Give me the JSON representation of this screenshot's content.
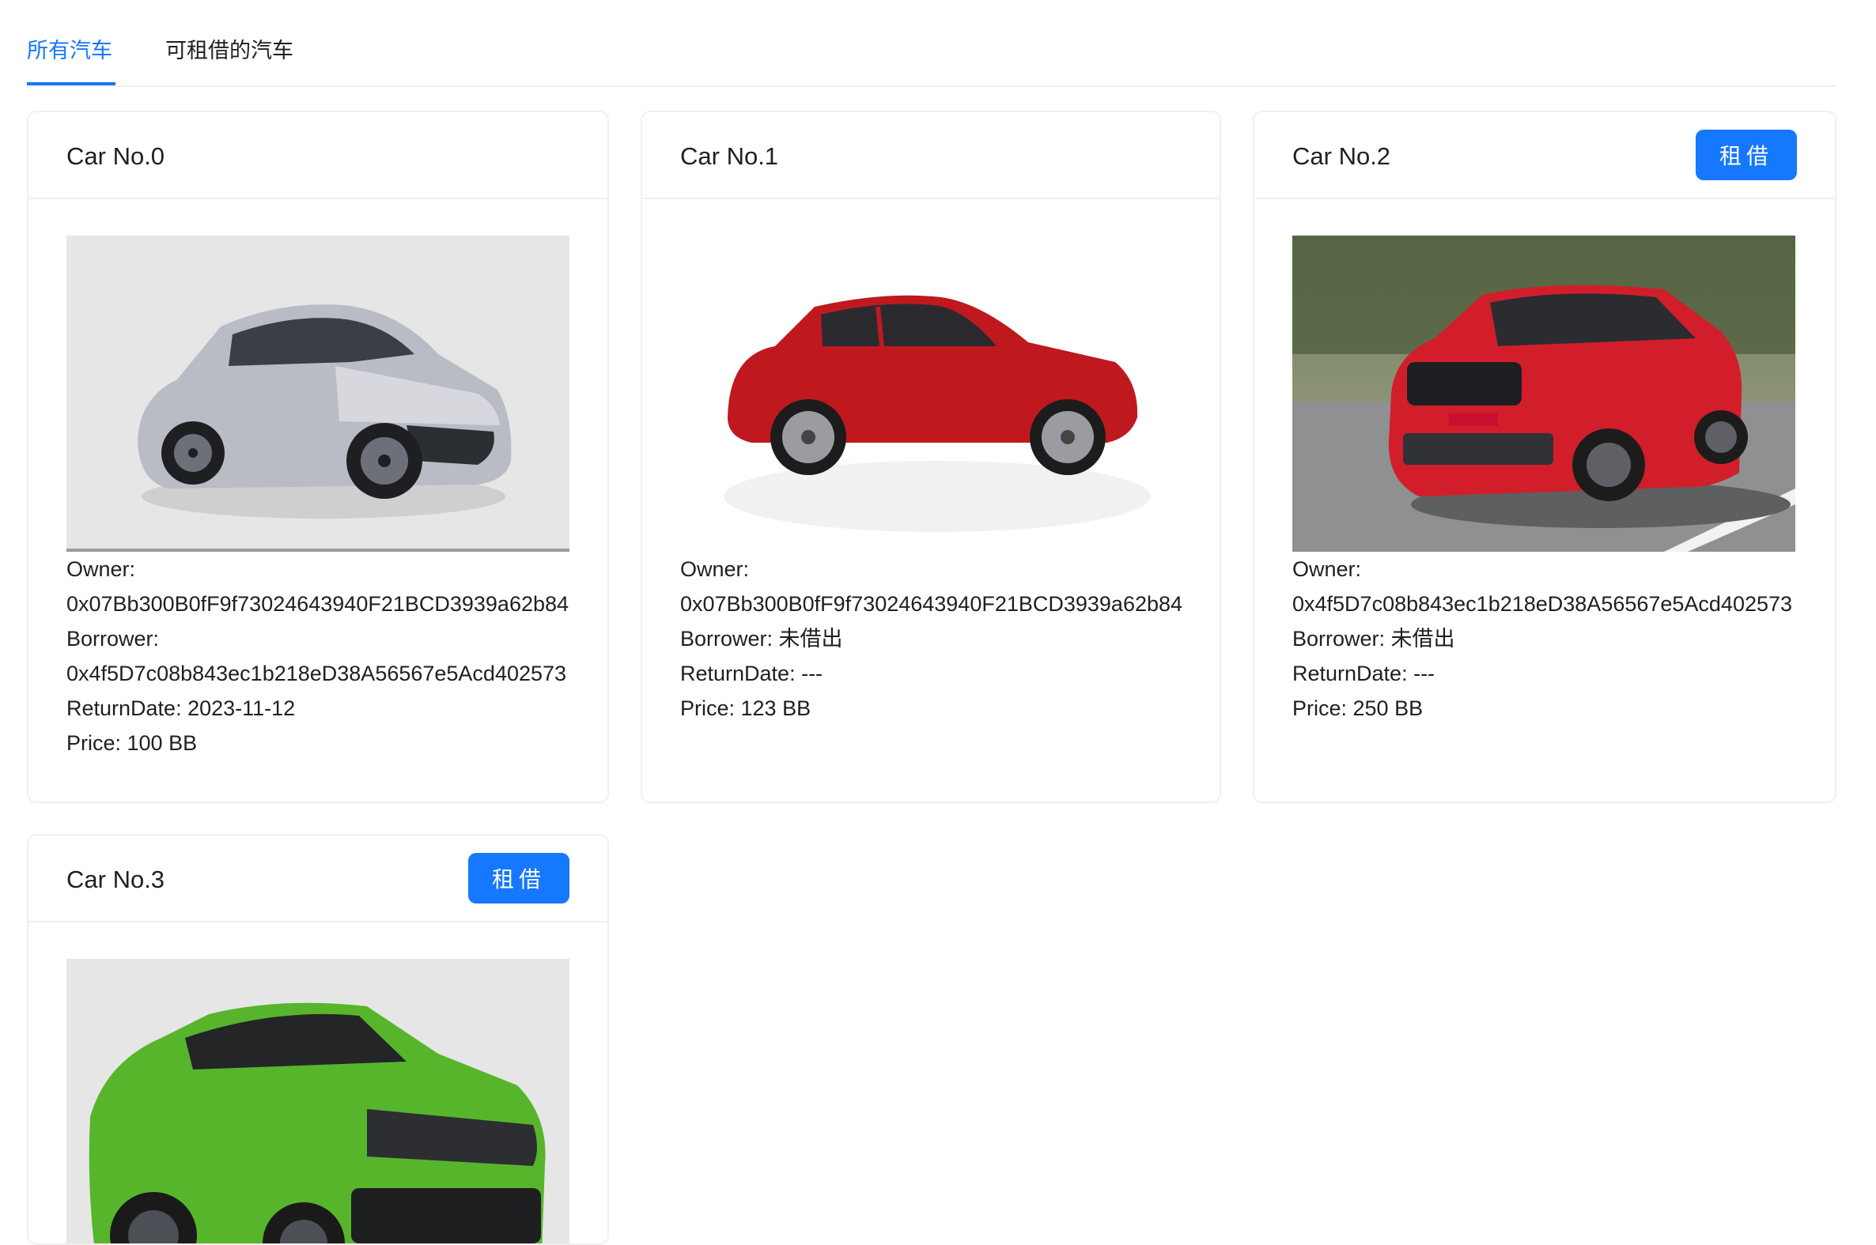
{
  "tabs": [
    {
      "label": "所有汽车",
      "active": true
    },
    {
      "label": "可租借的汽车",
      "active": false
    }
  ],
  "colors": {
    "accent": "#1677ff",
    "border": "#f0f0f0"
  },
  "cards": [
    {
      "title": "Car No.0",
      "image": "silver-sedan",
      "rent_button": null,
      "owner_label": "Owner:",
      "owner": "0x07Bb300B0fF9f73024643940F21BCD3939a62b84",
      "borrower_label": "Borrower:",
      "borrower": "0x4f5D7c08b843ec1b218eD38A56567e5Acd402573",
      "return_date": "ReturnDate: 2023-11-12",
      "price": "Price: 100 BB"
    },
    {
      "title": "Car No.1",
      "image": "red-hatchback",
      "rent_button": null,
      "owner_label": "Owner:",
      "owner": "0x07Bb300B0fF9f73024643940F21BCD3939a62b84",
      "borrower": "Borrower: 未借出",
      "return_date": "ReturnDate: ---",
      "price": "Price: 123 BB"
    },
    {
      "title": "Car No.2",
      "image": "red-suv-on-road",
      "rent_button": "租借",
      "owner_label": "Owner:",
      "owner": "0x4f5D7c08b843ec1b218eD38A56567e5Acd402573",
      "borrower": "Borrower: 未借出",
      "return_date": "ReturnDate: ---",
      "price": "Price: 250 BB"
    },
    {
      "title": "Car No.3",
      "image": "green-suv",
      "rent_button": "租借"
    }
  ]
}
